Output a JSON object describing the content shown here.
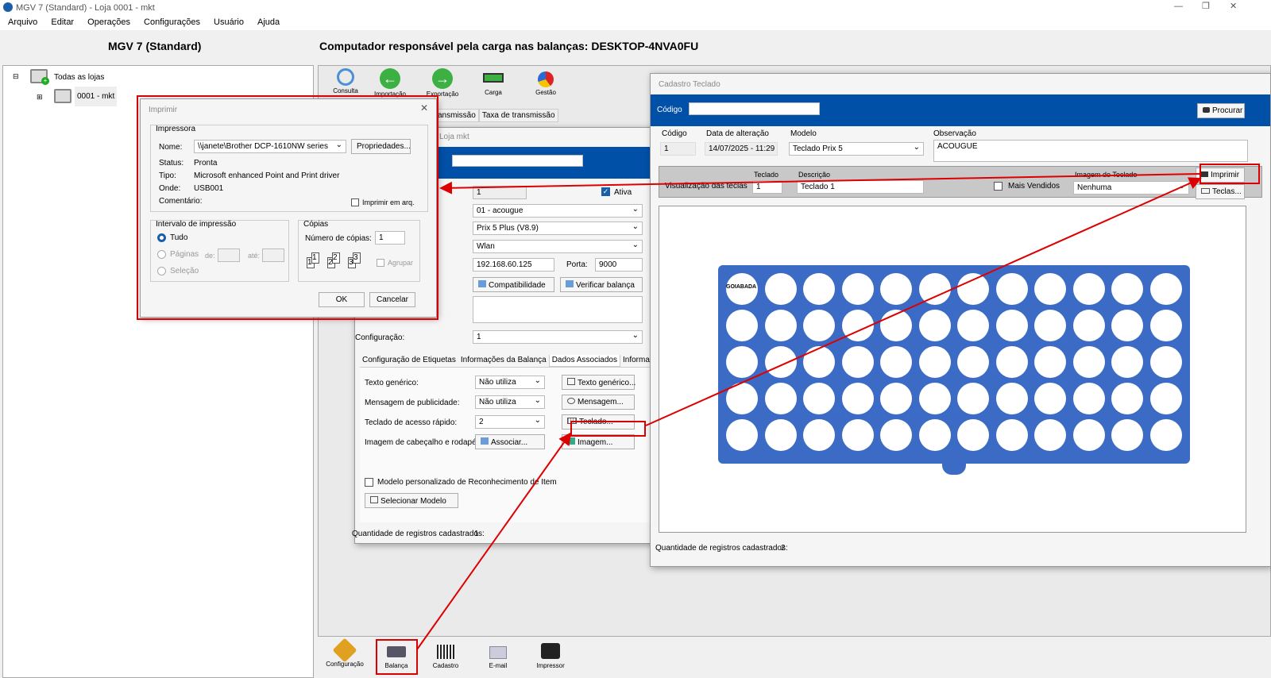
{
  "window": {
    "title": "MGV 7 (Standard) - Loja 0001 - mkt",
    "app_icon": "app-logo-icon"
  },
  "menu": [
    "Arquivo",
    "Editar",
    "Operações",
    "Configurações",
    "Usuário",
    "Ajuda"
  ],
  "header": {
    "app_name": "MGV 7 (Standard)",
    "computer_label": "Computador responsável pela carga nas balanças: DESKTOP-4NVA0FU"
  },
  "tree": {
    "root": "Todas as lojas",
    "child": "0001 - mkt"
  },
  "toolbar_top": [
    "Consulta",
    "Importação",
    "Exportação",
    "Carga",
    "Gestão"
  ],
  "toolbar_bottom": [
    "Configuração",
    "Balança",
    "Cadastro",
    "E-mail",
    "Impressor"
  ],
  "balanca_window": {
    "title": "Loja mkt",
    "tabs_top": [
      "ansmissão",
      "Taxa de transmissão"
    ],
    "code": "1",
    "ativa": "Ativa",
    "dept": "01 - acougue",
    "model": "Prix 5 Plus (V8.9)",
    "conn": "Wlan",
    "ip": "192.168.60.125",
    "porta_label": "Porta:",
    "porta": "9000",
    "compat": "Compatibilidade",
    "verificar": "Verificar balança",
    "config_label": "Configuração:",
    "config": "1",
    "tabs": [
      "Configuração de Etiquetas",
      "Informações da Balança",
      "Dados Associados",
      "Informações T"
    ],
    "rows": [
      {
        "label": "Texto genérico:",
        "value": "Não utiliza",
        "button": "Texto genérico..."
      },
      {
        "label": "Mensagem de publicidade:",
        "value": "Não utiliza",
        "button": "Mensagem..."
      },
      {
        "label": "Teclado de acesso rápido:",
        "value": "2",
        "button": "Teclado..."
      },
      {
        "label": "Imagem de cabeçalho e rodapé:",
        "value": "Associar...",
        "button": "Imagem..."
      }
    ],
    "modelo_chk": "Modelo personalizado de Reconhecimento de Item",
    "selecionar": "Selecionar Modelo",
    "qtd_label": "Quantidade de registros cadastrados:",
    "qtd": "1"
  },
  "imprimir": {
    "title": "Imprimir",
    "impressora": "Impressora",
    "nome_label": "Nome:",
    "nome": "\\\\janete\\Brother DCP-1610NW series",
    "propriedades": "Propriedades...",
    "status_label": "Status:",
    "status": "Pronta",
    "tipo_label": "Tipo:",
    "tipo": "Microsoft enhanced Point and Print driver",
    "onde_label": "Onde:",
    "onde": "USB001",
    "comentario_label": "Comentário:",
    "imprimir_arq": "Imprimir em arq.",
    "intervalo": "Intervalo de impressão",
    "tudo": "Tudo",
    "paginas": "Páginas",
    "de": "de:",
    "ate": "até:",
    "selecao": "Seleção",
    "copias": "Cópias",
    "num_copias": "Número de cópias:",
    "num": "1",
    "agrupar": "Agrupar",
    "ok": "OK",
    "cancelar": "Cancelar"
  },
  "teclado": {
    "title": "Cadastro Teclado",
    "codigo": "Código",
    "procurar": "Procurar",
    "col_codigo": "Código",
    "col_data": "Data de alteração",
    "col_modelo": "Modelo",
    "col_obs": "Observação",
    "v_codigo": "1",
    "v_data": "14/07/2025 - 11:29",
    "v_modelo": "Teclado Prix 5",
    "v_obs": "ACOUGUE",
    "visualizacao": "Visualização das teclas",
    "teclado_lbl": "Teclado",
    "teclado_val": "1",
    "descricao_lbl": "Descrição",
    "descricao": "Teclado 1",
    "mais_vendidos": "Mais Vendidos",
    "imagem_lbl": "Imagem do Teclado",
    "imagem": "Nenhuma",
    "imprimir": "Imprimir",
    "teclas": "Teclas...",
    "first_key": "GOIABADA",
    "qtd_label": "Quantidade de registros cadastrados:",
    "qtd": "2"
  },
  "colors": {
    "blue": "#0050a8",
    "keyboard": "#3b6bc4",
    "red": "#d00000"
  }
}
